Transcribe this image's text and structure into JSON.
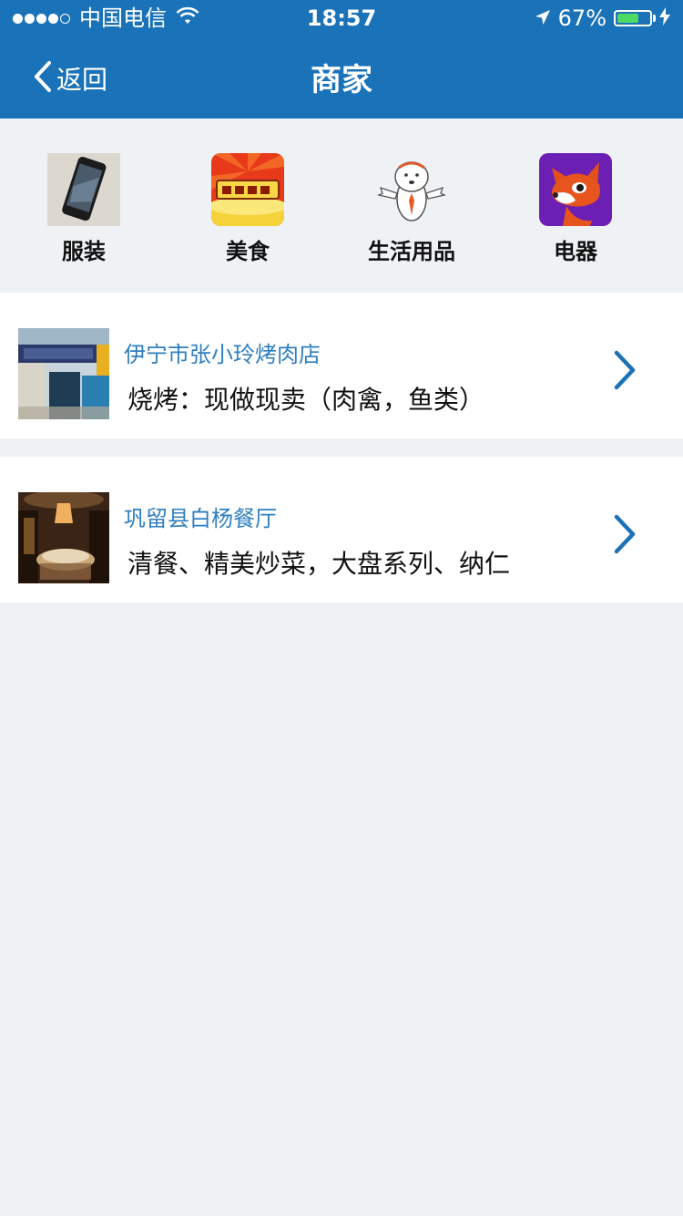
{
  "status_bar": {
    "carrier": "中国电信",
    "time": "18:57",
    "battery": "67%",
    "battery_level": 0.67
  },
  "nav": {
    "back_label": "返回",
    "title": "商家"
  },
  "categories": [
    {
      "label": "服装",
      "icon": "phone-photo-icon"
    },
    {
      "label": "美食",
      "icon": "lottery-icon"
    },
    {
      "label": "生活用品",
      "icon": "cartoon-figure-icon"
    },
    {
      "label": "电器",
      "icon": "fox-icon"
    }
  ],
  "shops": [
    {
      "name": "伊宁市张小玲烤肉店",
      "desc": "烧烤：现做现卖（肉禽，鱼类）"
    },
    {
      "name": "巩留县白杨餐厅",
      "desc": "清餐、精美炒菜，大盘系列、纳仁"
    }
  ],
  "colors": {
    "accent": "#1a72b8",
    "shop_name": "#2f7fc0",
    "background": "#eff2f5"
  }
}
